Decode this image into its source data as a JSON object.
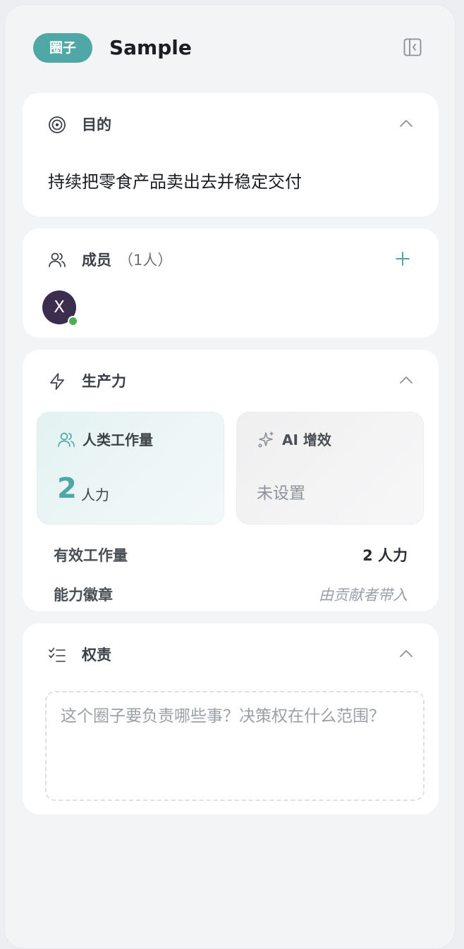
{
  "header": {
    "badge": "圈子",
    "title": "Sample",
    "collapse_icon": "sidebar-collapse-icon"
  },
  "purpose": {
    "label": "目的",
    "icon": "target-icon",
    "text": "持续把零食产品卖出去并稳定交付"
  },
  "members": {
    "label": "成员",
    "count": "（1人）",
    "icon": "users-icon",
    "list": [
      {
        "initial": "X",
        "status": "online"
      }
    ]
  },
  "productivity": {
    "label": "生产力",
    "icon": "zap-icon",
    "human": {
      "label": "人类工作量",
      "value": "2",
      "unit": "人力"
    },
    "ai": {
      "label": "AI 增效",
      "value": "未设置"
    },
    "rows": [
      {
        "key": "有效工作量",
        "value": "2 人力"
      },
      {
        "key": "能力徽章",
        "value": "由贡献者带入"
      }
    ]
  },
  "responsibilities": {
    "label": "权责",
    "icon": "checklist-icon",
    "placeholder": "这个圈子要负责哪些事？决策权在什么范围？"
  },
  "colors": {
    "accent": "#4fa8a6",
    "avatar": "#3a2d4d",
    "online": "#4caf50"
  }
}
